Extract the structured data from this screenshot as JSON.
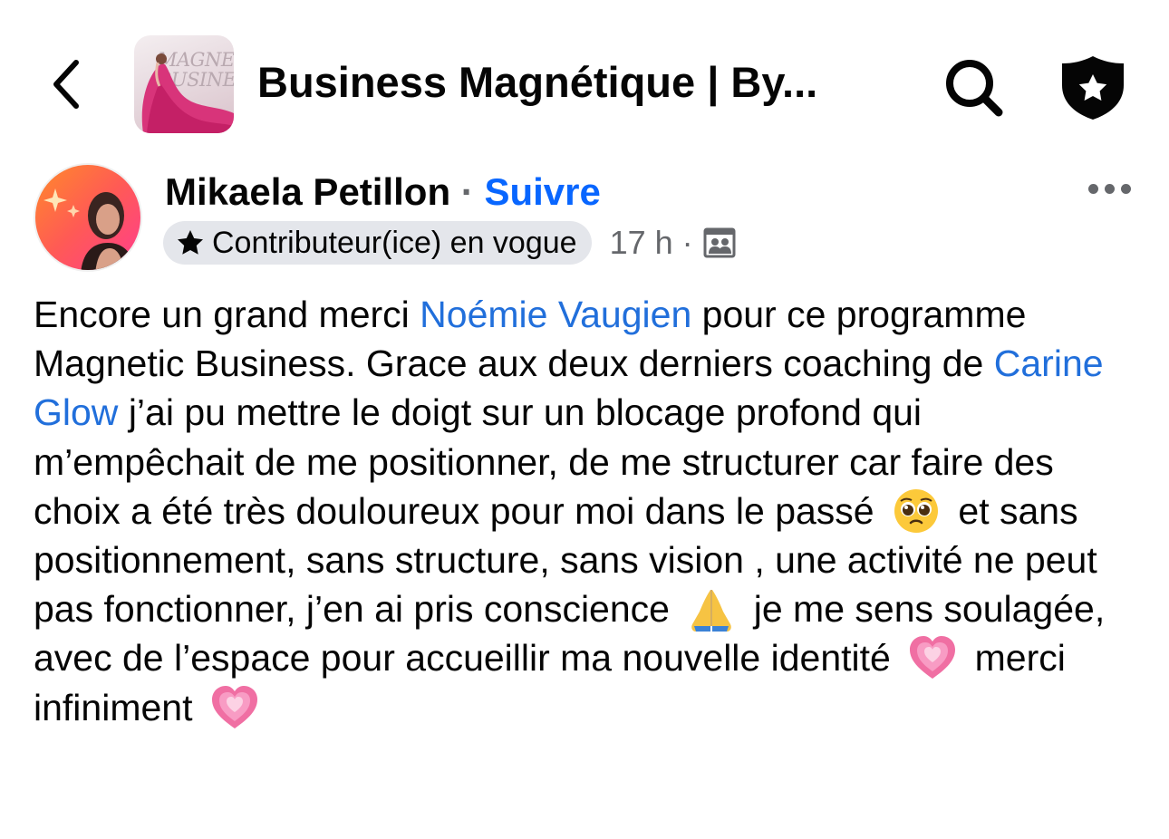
{
  "header": {
    "group_title": "Business Magnétique | By...",
    "thumbnail_text": "MAGNETIC BUSINESS"
  },
  "post": {
    "author_name": "Mikaela Petillon",
    "separator": "·",
    "follow_label": "Suivre",
    "badge_label": "Contributeur(ice) en vogue",
    "time": "17 h",
    "meta_dot": "·",
    "body": {
      "s1": "Encore un grand merci ",
      "m1": "Noémie Vaugien",
      "s2": " pour ce programme Magnetic Business. Grace aux deux derniers coaching de ",
      "m2": "Carine Glow",
      "s3": " j’ai pu mettre le doigt sur un blocage profond qui m’empêchait de me positionner, de me structurer car faire des choix a été très douloureux pour moi dans le passé ",
      "s4": " et sans positionnement, sans structure, sans vision , une activité ne peut pas fonctionner, j’en ai pris conscience ",
      "s5": " je me sens soulagée, avec de l’espace pour accueillir ma nouvelle identité ",
      "s6": " merci infiniment "
    }
  },
  "icons": {
    "back": "chevron-left-icon",
    "search": "search-icon",
    "shield": "shield-star-icon",
    "more": "more-horizontal-icon",
    "badge": "star-icon",
    "audience": "group-audience-icon",
    "emoji_1": "pleading-face-emoji",
    "emoji_2": "folded-hands-emoji",
    "emoji_3": "growing-heart-emoji"
  },
  "colors": {
    "link": "#216fdb",
    "follow": "#0866ff",
    "secondary": "#65676b",
    "badge_bg": "#e4e6eb"
  }
}
